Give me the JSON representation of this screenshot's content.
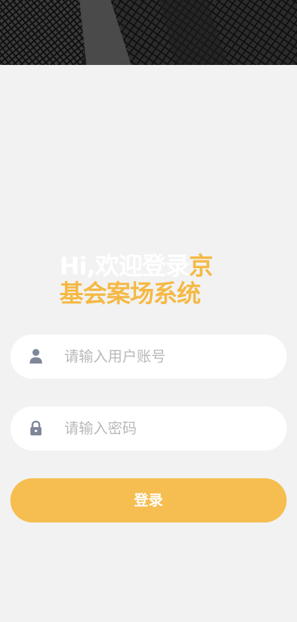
{
  "greeting": {
    "prefix": "Hi,欢迎登录",
    "highlight_line1": "京",
    "highlight_line2": "基会案场系统"
  },
  "login_form": {
    "username_placeholder": "请输入用户账号",
    "password_placeholder": "请输入密码",
    "submit_label": "登录"
  },
  "icons": {
    "username": "user-icon",
    "password": "lock-icon"
  },
  "colors": {
    "background": "#f2f2f2",
    "accent": "#f5b944",
    "button": "#f6be50",
    "icon": "#7f8799",
    "placeholder": "#b9b9b9"
  }
}
